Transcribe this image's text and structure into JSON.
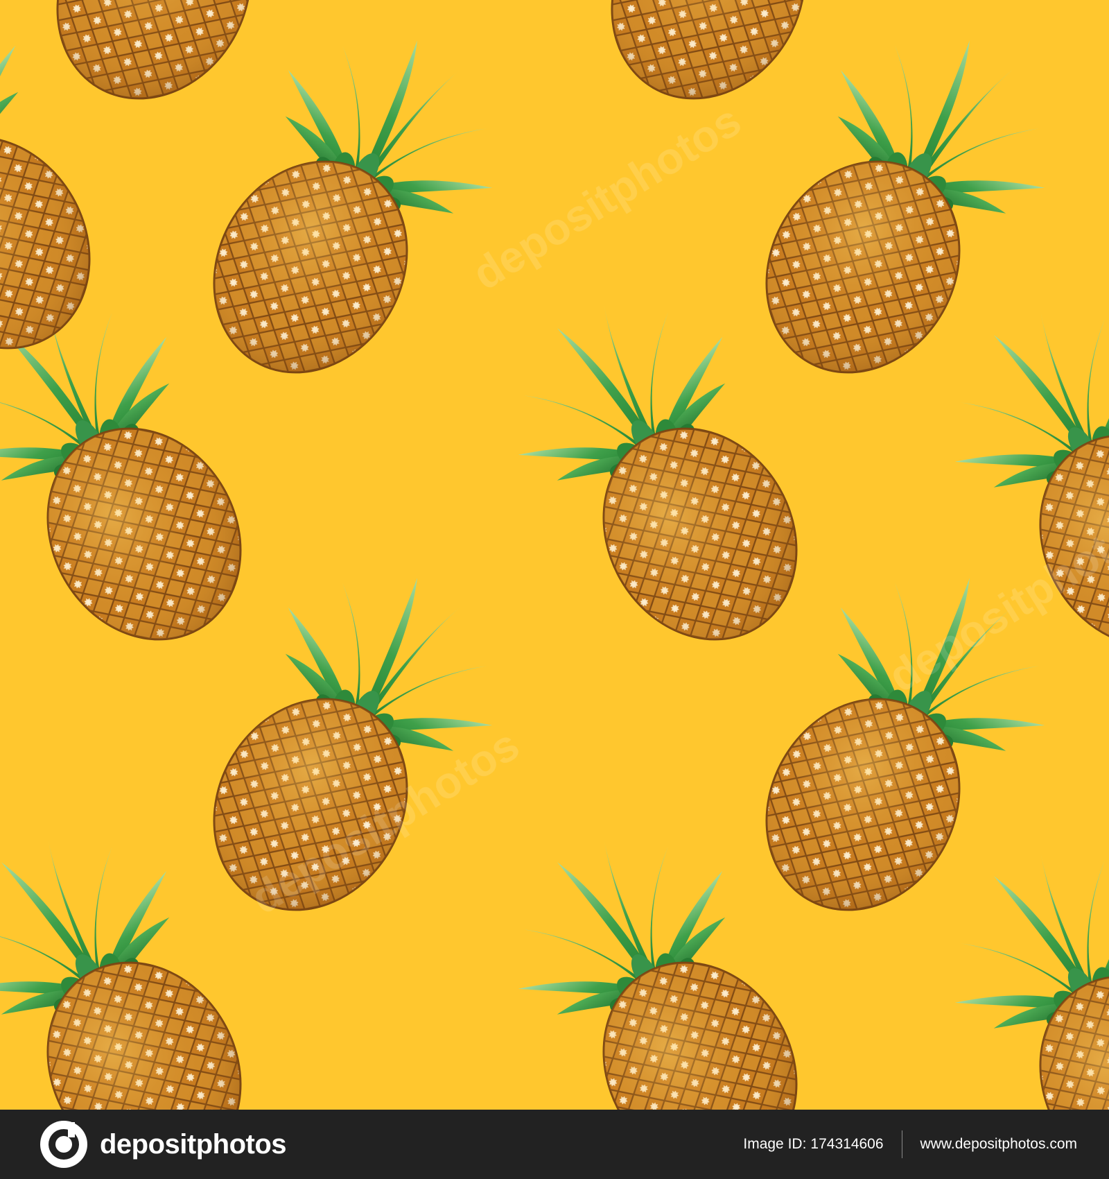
{
  "scene": {
    "background_color": "#FFC72E",
    "subject": "pineapple",
    "pattern": "seamless-diagonal-tile"
  },
  "watermark": {
    "text": "depositphotos",
    "color": "rgba(255,255,255,0.18)"
  },
  "footer": {
    "brand_name": "depositphotos",
    "image_id_label": "Image ID:",
    "image_id_value": "174314606",
    "site_url": "www.depositphotos.com",
    "background_color": "#222222"
  }
}
